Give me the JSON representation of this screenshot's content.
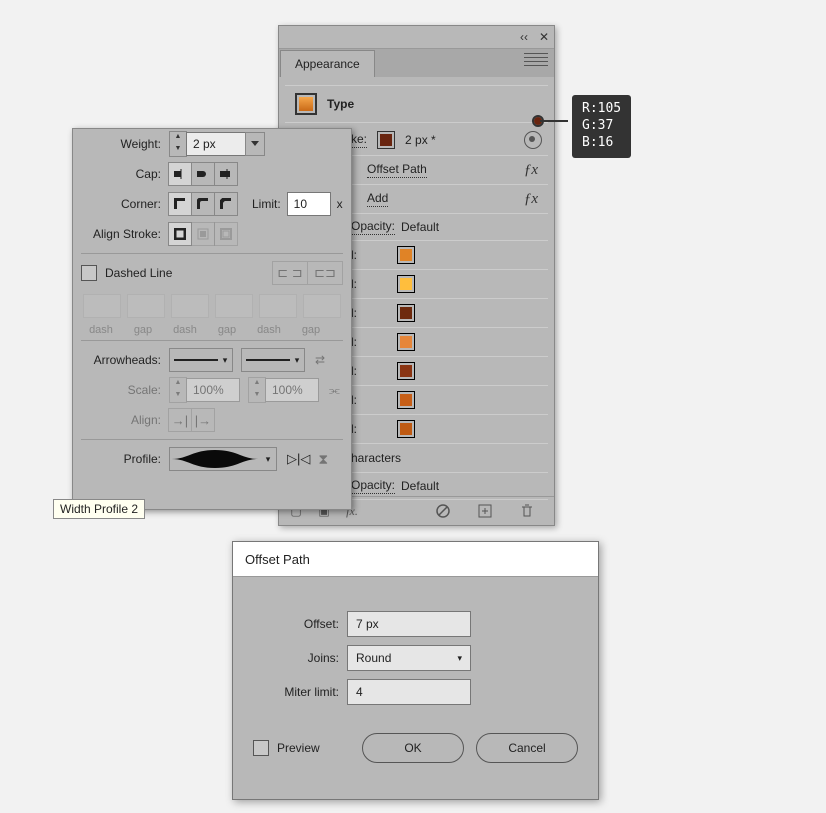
{
  "appearance": {
    "title": "Appearance",
    "type_label": "Type",
    "type_swatch": "#e08326",
    "stroke_label": "Stroke:",
    "stroke_swatch": "#692510",
    "stroke_weight": "2 px *",
    "effects": [
      {
        "label": "Offset Path"
      },
      {
        "label": "Add"
      }
    ],
    "opacity_label": "Opacity:",
    "opacity_value": "Default",
    "fill_label": "l:",
    "fills": [
      "#e08326",
      "#ffbe3d",
      "#6e2a0e",
      "#e6863a",
      "#8a3412",
      "#c75e16",
      "#bf5a12"
    ],
    "chars_label": "haracters",
    "opacity2_label": "Opacity:",
    "opacity2_value": "Default",
    "fx_label": "fx."
  },
  "rgb": {
    "r_label": "R:",
    "r": "105",
    "g_label": "G:",
    "g": "37",
    "b_label": "B:",
    "b": "16"
  },
  "stroke_panel": {
    "weight_label": "Weight:",
    "weight": "2 px",
    "cap_label": "Cap:",
    "corner_label": "Corner:",
    "limit_label": "Limit:",
    "limit": "10",
    "limit_suffix": "x",
    "align_label": "Align Stroke:",
    "dashed_label": "Dashed Line",
    "dash_labels": [
      "dash",
      "gap",
      "dash",
      "gap",
      "dash",
      "gap"
    ],
    "arrow_label": "Arrowheads:",
    "scale_label": "Scale:",
    "scale1": "100%",
    "scale2": "100%",
    "align2_label": "Align:",
    "profile_label": "Profile:"
  },
  "tooltip": {
    "text": "Width Profile 2"
  },
  "offset_dialog": {
    "title": "Offset Path",
    "offset_label": "Offset:",
    "offset": "7 px",
    "joins_label": "Joins:",
    "joins": "Round",
    "miter_label": "Miter limit:",
    "miter": "4",
    "preview_label": "Preview",
    "ok": "OK",
    "cancel": "Cancel"
  }
}
